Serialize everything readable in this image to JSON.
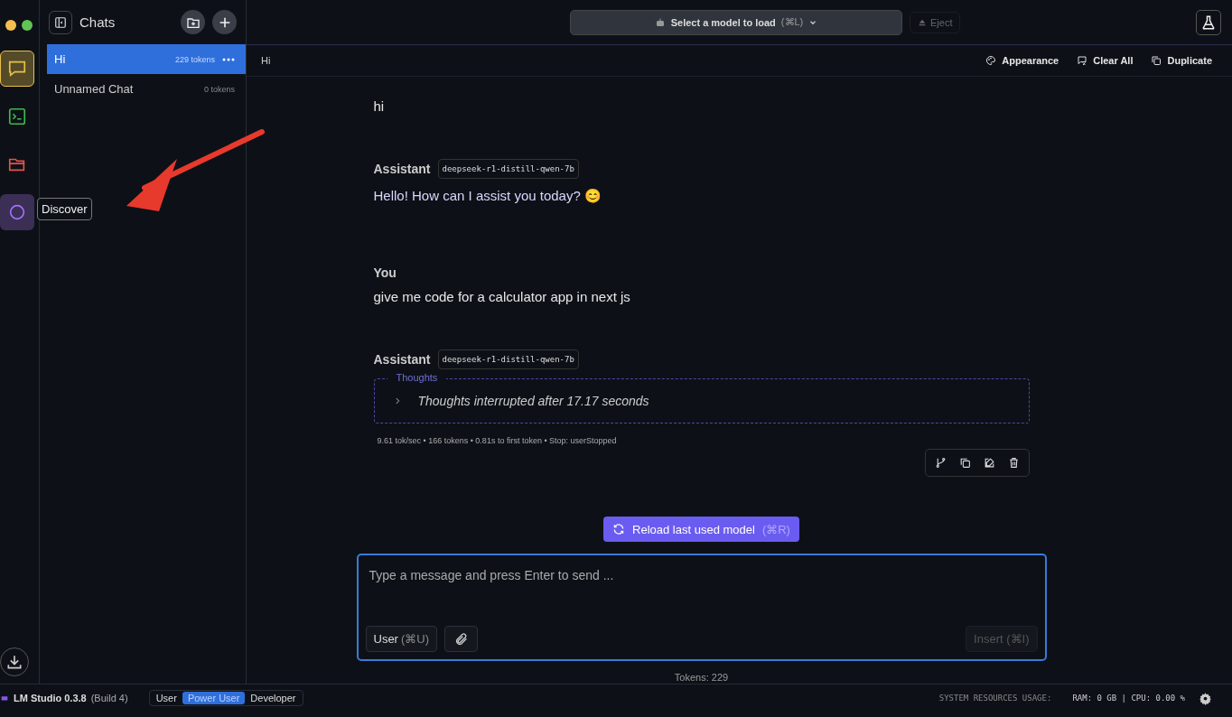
{
  "sidebar": {
    "title": "Chats",
    "rail": [
      {
        "kind": "chat",
        "color": "#e8c04a",
        "selected": true
      },
      {
        "kind": "terminal",
        "color": "#3fb950",
        "selected": false
      },
      {
        "kind": "folder",
        "color": "#e5534b",
        "selected": false
      },
      {
        "kind": "discover",
        "color": "#a371f7",
        "selected": false
      }
    ],
    "tooltip": "Discover",
    "chats": [
      {
        "name": "Hi",
        "tokens": "229 tokens",
        "selected": true
      },
      {
        "name": "Unnamed Chat",
        "tokens": "0 tokens",
        "selected": false
      }
    ]
  },
  "topbar": {
    "model_select": {
      "label": "Select a model to load",
      "shortcut": "(⌘L)"
    },
    "eject": {
      "label": "Eject",
      "disabled": true
    }
  },
  "chat_header": {
    "title": "Hi",
    "actions": [
      {
        "kind": "palette",
        "label": "Appearance"
      },
      {
        "kind": "clear",
        "label": "Clear All"
      },
      {
        "kind": "duplicate",
        "label": "Duplicate"
      }
    ]
  },
  "messages": [
    {
      "kind": "user",
      "text": "hi"
    },
    {
      "kind": "assistant",
      "sender": "Assistant",
      "model": "deepseek-r1-distill-qwen-7b",
      "text": "Hello! How can I assist you today? 😊"
    },
    {
      "kind": "user",
      "sender": "You",
      "text": "give me code for a calculator app in next js"
    },
    {
      "kind": "assistant",
      "sender": "Assistant",
      "model": "deepseek-r1-distill-qwen-7b",
      "thoughts": {
        "label": "Thoughts",
        "text": "Thoughts interrupted after 17.17 seconds",
        "expanded": false
      },
      "stats": "9.61 tok/sec • 166 tokens • 0.81s to first token • Stop: userStopped"
    }
  ],
  "reload_button": {
    "label": "Reload last used model",
    "shortcut": "(⌘R)"
  },
  "composer": {
    "placeholder": "Type a message and press Enter to send ...",
    "role": {
      "label": "User",
      "shortcut": "(⌘U)"
    },
    "insert": {
      "label": "Insert",
      "shortcut": "(⌘I)",
      "disabled": true
    }
  },
  "token_count": "Tokens: 229",
  "status_bar": {
    "app": "LM Studio 0.3.8",
    "build": "(Build 4)",
    "modes": [
      {
        "label": "User",
        "selected": false
      },
      {
        "label": "Power User",
        "selected": true
      },
      {
        "label": "Developer",
        "selected": false
      }
    ],
    "resources_label": "SYSTEM RESOURCES USAGE:",
    "resources": "RAM: 0 GB | CPU: 0.00 %"
  }
}
